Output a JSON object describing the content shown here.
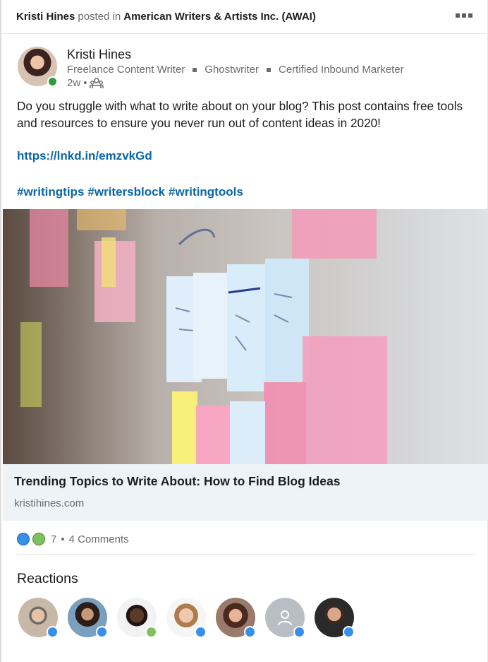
{
  "header": {
    "poster": "Kristi Hines",
    "posted_in": "posted in",
    "group": "American Writers & Artists Inc. (AWAI)"
  },
  "author": {
    "name": "Kristi Hines",
    "headline": [
      "Freelance Content Writer",
      "Ghostwriter",
      "Certified Inbound Marketer"
    ],
    "time": "2w",
    "visibility_icon": "group-icon"
  },
  "post": {
    "text": "Do you struggle with what to write about on your blog? This post contains free tools and resources to ensure you never run out of content ideas in 2020!",
    "link": "https://lnkd.in/emzvkGd",
    "hashtags": [
      "#writingtips",
      "#writersblock",
      "#writingtools"
    ]
  },
  "link_preview": {
    "title": "Trending Topics to Write About: How to Find Blog Ideas",
    "domain": "kristihines.com"
  },
  "social": {
    "reaction_count": "7",
    "separator": "•",
    "comments": "4 Comments"
  },
  "reactions": {
    "title": "Reactions"
  },
  "colors": {
    "link": "#0a66a6",
    "like": "#378fe9",
    "insight": "#7fc15e",
    "online": "#2f9b3f",
    "preview_bg": "#eef3f8"
  }
}
